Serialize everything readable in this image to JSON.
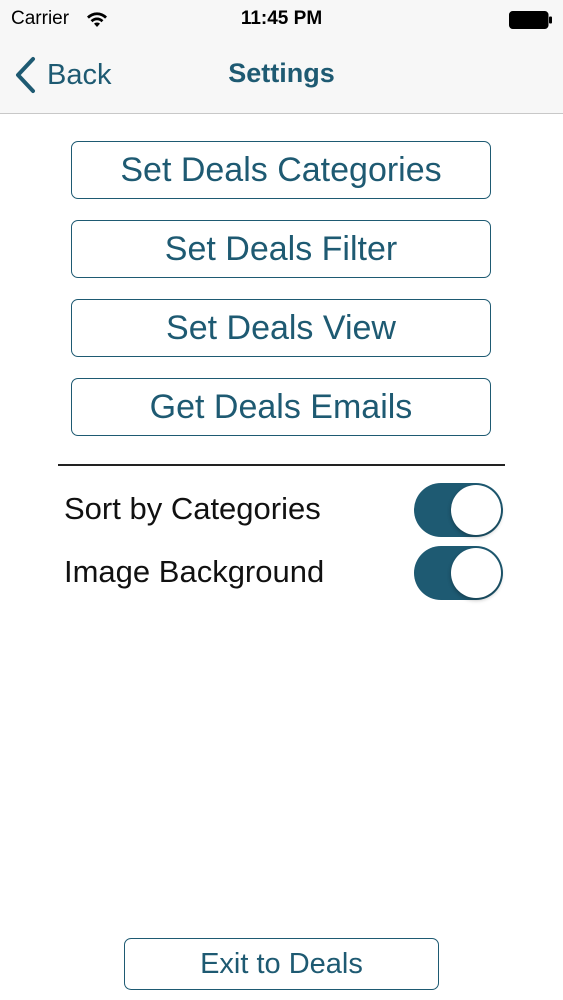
{
  "status_bar": {
    "carrier": "Carrier",
    "time": "11:45 PM",
    "wifi_icon": "wifi-icon",
    "battery_icon": "battery-icon"
  },
  "nav": {
    "back_label": "Back",
    "title": "Settings"
  },
  "menu_buttons": [
    {
      "label": "Set Deals Categories"
    },
    {
      "label": "Set Deals Filter"
    },
    {
      "label": "Set Deals View"
    },
    {
      "label": "Get Deals Emails"
    }
  ],
  "toggles": [
    {
      "label": "Sort by Categories",
      "on": true
    },
    {
      "label": "Image Background",
      "on": true
    }
  ],
  "footer": {
    "exit_label": "Exit to Deals"
  },
  "colors": {
    "accent": "#1e5a72",
    "bar_background": "#f7f7f7",
    "text": "#111111"
  }
}
